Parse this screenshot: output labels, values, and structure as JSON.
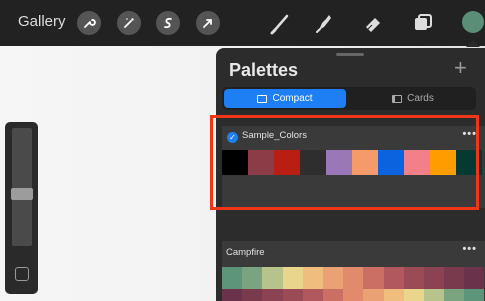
{
  "toolbar": {
    "gallery_label": "Gallery",
    "actions": [
      "wrench-icon",
      "magic-wand-icon",
      "selection-s-icon",
      "transform-arrow-icon"
    ],
    "tools": [
      "brush-icon",
      "smudge-icon",
      "eraser-icon",
      "layers-icon"
    ],
    "current_color": "#5a8e76"
  },
  "palettes": {
    "title": "Palettes",
    "add_icon": "+",
    "tabs": [
      {
        "label": "Compact",
        "active": true
      },
      {
        "label": "Cards",
        "active": false
      }
    ],
    "items": [
      {
        "name": "Sample_Colors",
        "selected": true,
        "more": "•••",
        "colors": [
          "#000000",
          "#8b3c47",
          "#b81f12",
          "#2e2e2e",
          "#9a77b6",
          "#f59a6a",
          "#0c63e0",
          "#f37f88",
          "#ff9c00",
          "#053a33"
        ]
      },
      {
        "name": "Campfire",
        "selected": false,
        "more": "•••",
        "colors": [
          "#5d957b",
          "#7aa480",
          "#b6c38a",
          "#e9d68c",
          "#efbd7e",
          "#eaa174",
          "#e18a6c",
          "#cb6e63",
          "#b0585e",
          "#9a4b55",
          "#8b4252",
          "#7a3a4e",
          "#6a334b"
        ]
      }
    ]
  },
  "highlight_color": "#f03616"
}
